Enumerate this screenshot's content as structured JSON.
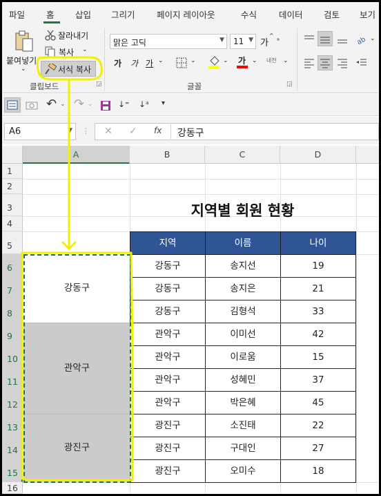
{
  "ribbon_tabs": [
    "파일",
    "홈",
    "삽입",
    "그리기",
    "페이지 레이아웃",
    "수식",
    "데이터",
    "검토",
    "보기"
  ],
  "active_tab": "홈",
  "clipboard": {
    "paste_label": "붙여넣기",
    "cut_label": "잘라내기",
    "copy_label": "복사",
    "format_painter_label": "서식 복사",
    "group_label": "클립보드"
  },
  "font": {
    "font_name": "맑은 고딕",
    "font_size": "11",
    "grow_label": "가",
    "bold_label": "가",
    "italic_label": "가",
    "underline_label": "가",
    "fill_label": "가",
    "phonetic_label": "내천",
    "group_label": "글꼴"
  },
  "name_box": "A6",
  "formula_value": "강동구",
  "formula_fx": "fx",
  "columns": [
    "A",
    "B",
    "C",
    "D"
  ],
  "rows": [
    "1",
    "2",
    "3",
    "4",
    "5",
    "6",
    "7",
    "8",
    "9",
    "10",
    "11",
    "12",
    "13",
    "14",
    "15",
    "16"
  ],
  "selected_column": "A",
  "sheet_title": "지역별 회원 현황",
  "table_headers": [
    "지역",
    "이름",
    "나이"
  ],
  "table_rows": [
    [
      "강동구",
      "송지선",
      "19"
    ],
    [
      "강동구",
      "송지은",
      "21"
    ],
    [
      "강동구",
      "김형석",
      "33"
    ],
    [
      "관악구",
      "이미선",
      "42"
    ],
    [
      "관악구",
      "이로움",
      "15"
    ],
    [
      "관악구",
      "성혜민",
      "37"
    ],
    [
      "관악구",
      "박은혜",
      "45"
    ],
    [
      "광진구",
      "소진태",
      "22"
    ],
    [
      "광진구",
      "구대인",
      "27"
    ],
    [
      "광진구",
      "오미수",
      "18"
    ]
  ],
  "column_a_blocks": [
    "강동구",
    "관악구",
    "광진구"
  ],
  "colors": {
    "header_fill": "#2f5597",
    "annotation": "#f0f000",
    "gray_fill": "#cbcbcb",
    "accent": "#217346"
  }
}
